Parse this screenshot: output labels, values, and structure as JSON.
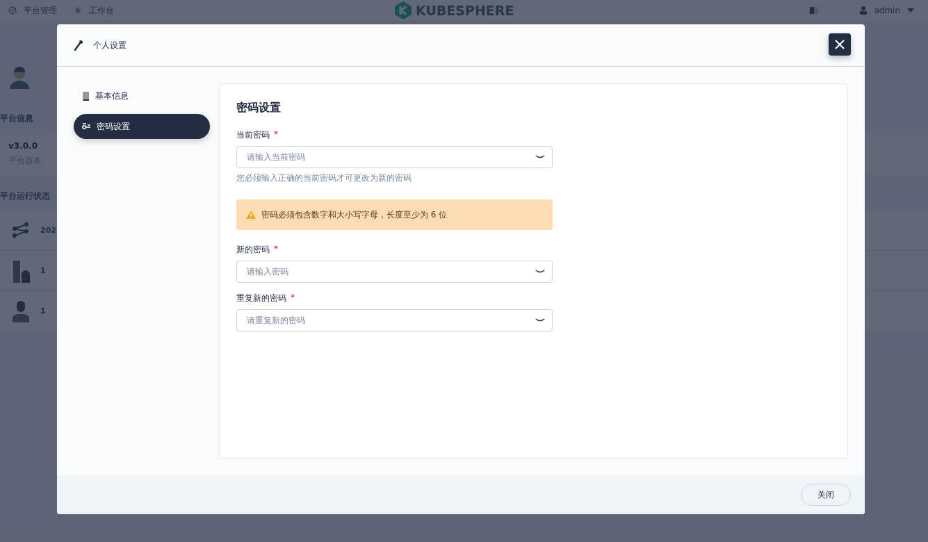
{
  "background_page": {
    "top_bar": {
      "nav": [
        {
          "label": "平台管理",
          "kind": "gear"
        },
        {
          "label": "工作台",
          "kind": "dot"
        }
      ],
      "logo": "KUBESPHERE",
      "user": "admin"
    },
    "platform_info": {
      "title": "平台信息",
      "version": "v3.0.0",
      "version_label": "平台版本"
    },
    "platform_status": {
      "title": "平台运行状态",
      "rows": [
        {
          "kind": "cluster",
          "value": "202"
        },
        {
          "kind": "workspace",
          "value": "1"
        },
        {
          "kind": "account",
          "value": "1"
        }
      ]
    }
  },
  "dialog": {
    "title": "个人设置",
    "menu": [
      {
        "label": "基本信息",
        "kind": "info",
        "selected": false
      },
      {
        "label": "密码设置",
        "kind": "key",
        "selected": true
      }
    ],
    "section_title": "密码设置",
    "items": [
      {
        "kind": "input",
        "label": "当前密码",
        "required_mark": "*",
        "placeholder": "请输入当前密码",
        "hint": "您必须输入正确的当前密码才可更改为新的密码"
      },
      {
        "kind": "alert",
        "text": "密码必须包含数字和大小写字母，长度至少为 6 位"
      },
      {
        "kind": "input",
        "label": "新的密码",
        "required_mark": "*",
        "placeholder": "请输入密码"
      },
      {
        "kind": "input",
        "label": "重复新的密码",
        "required_mark": "*",
        "placeholder": "请重复新的密码"
      }
    ],
    "footer_button": "关闭"
  }
}
